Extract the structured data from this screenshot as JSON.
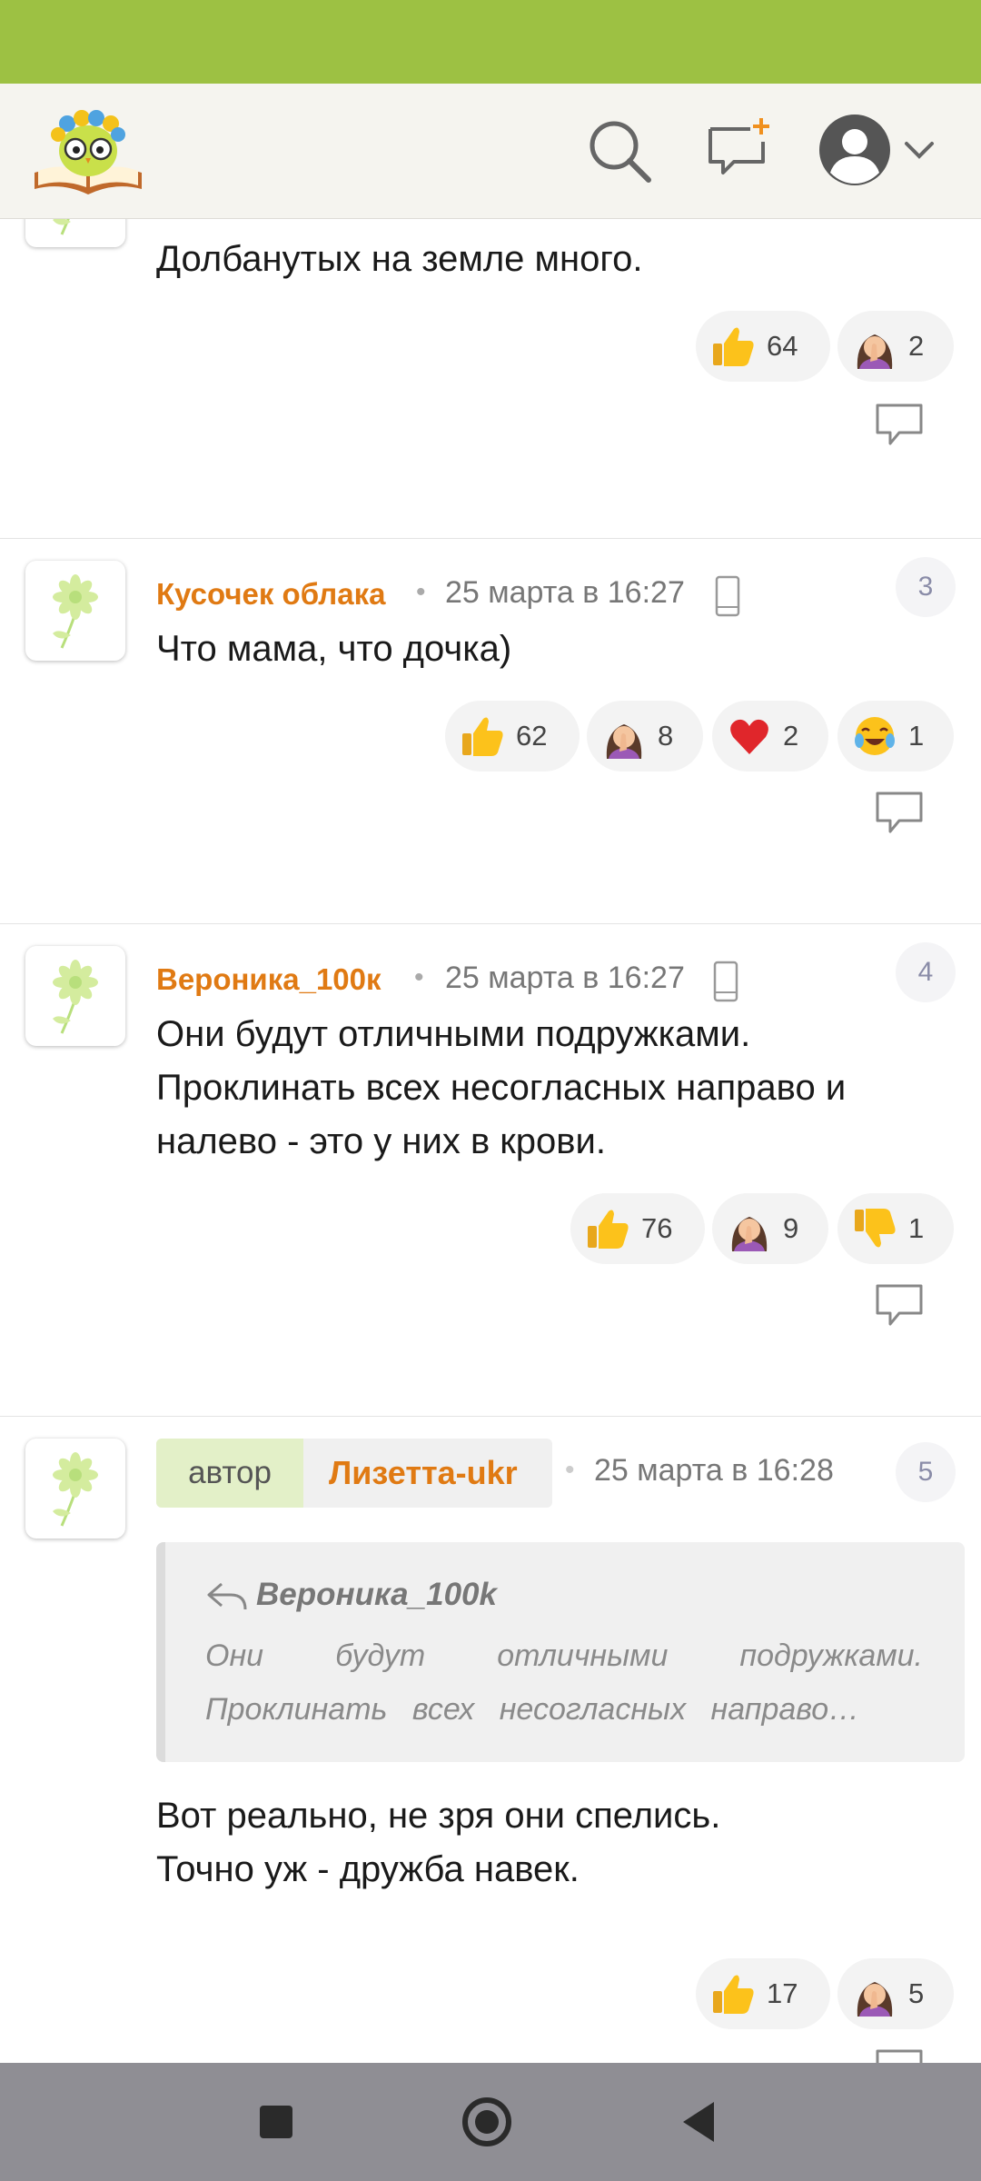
{
  "header": {
    "logo": "owl-book-logo",
    "search_icon": "search-icon",
    "new_post_icon": "add-chat-icon",
    "profile_icon": "user-avatar-icon",
    "menu_icon": "chevron-down-icon"
  },
  "colors": {
    "status_bar": "#9dc143",
    "username": "#e07a13",
    "app_bar": "#f5f4ef"
  },
  "comments": [
    {
      "username": "",
      "date": "",
      "text": "Долбанутых на земле много.",
      "reactions": [
        {
          "emoji": "thumbs-up",
          "count": "64"
        },
        {
          "emoji": "facepalm",
          "count": "2"
        }
      ]
    },
    {
      "username": "Кусочек облака",
      "date": "25 марта в 16:27",
      "number": "3",
      "text": "Что мама, что дочка)",
      "reactions": [
        {
          "emoji": "thumbs-up",
          "count": "62"
        },
        {
          "emoji": "facepalm",
          "count": "8"
        },
        {
          "emoji": "heart",
          "count": "2"
        },
        {
          "emoji": "tears-of-joy",
          "count": "1"
        }
      ]
    },
    {
      "username": "Вероника_100к",
      "date": "25 марта в 16:27",
      "number": "4",
      "text": "Они будут отличными подружками. Проклинать всех несогласных направо и налево - это у них в крови.",
      "reactions": [
        {
          "emoji": "thumbs-up",
          "count": "76"
        },
        {
          "emoji": "facepalm",
          "count": "9"
        },
        {
          "emoji": "thumbs-down",
          "count": "1"
        }
      ]
    },
    {
      "author_label": "автор",
      "username": "Лизетта-ukr",
      "date": "25 марта в 16:28",
      "number": "5",
      "quote": {
        "name": "Вероника_100k",
        "line1": "Они будут отличными подружками.",
        "line2": "Проклинать всех несогласных направо…"
      },
      "text_line1": "Вот реально, не зря они спелись.",
      "text_line2": "Точно уж - дружба навек.",
      "reactions": [
        {
          "emoji": "thumbs-up",
          "count": "17"
        },
        {
          "emoji": "facepalm",
          "count": "5"
        }
      ]
    }
  ],
  "navbar": {
    "recents": "square-icon",
    "home": "circle-icon",
    "back": "triangle-back-icon"
  }
}
